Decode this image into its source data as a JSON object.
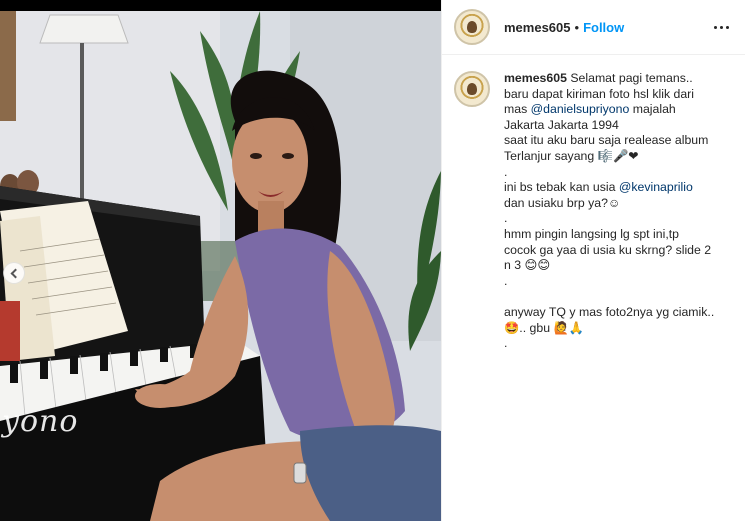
{
  "photo": {
    "watermark": "yono",
    "prev_icon": "chevron-left-icon"
  },
  "post": {
    "username": "memes605",
    "separator": "•",
    "follow_label": "Follow",
    "more_icon": "more-options-icon"
  },
  "caption": {
    "username": "memes605",
    "l1_text": "Selamat pagi temans..",
    "l2": "baru dapat kiriman foto hsl klik dari",
    "l3_pre": "mas ",
    "l3_mention": "@danielsupriyono",
    "l3_post": " majalah",
    "l4": "Jakarta Jakarta 1994",
    "l5": "saat itu aku baru saja realease album",
    "l6": "Terlanjur sayang 🎼🎤❤",
    "l7": ".",
    "l8_pre": "ini bs tebak kan usia ",
    "l8_mention": "@kevinaprilio",
    "l9": "dan usiaku brp ya?☺",
    "l10": ".",
    "l11": "hmm pingin langsing lg spt ini,tp",
    "l12": "cocok ga yaa di usia ku skrng? slide 2",
    "l13": "n 3 😊😊",
    "l14": ".",
    "l15": "",
    "l16": "anyway TQ y mas foto2nya yg ciamik..",
    "l17": "🤩.. gbu 🙋🙏",
    "l18": "."
  },
  "colors": {
    "link_blue": "#0095f6",
    "mention_blue": "#00376b",
    "text": "#262626"
  }
}
